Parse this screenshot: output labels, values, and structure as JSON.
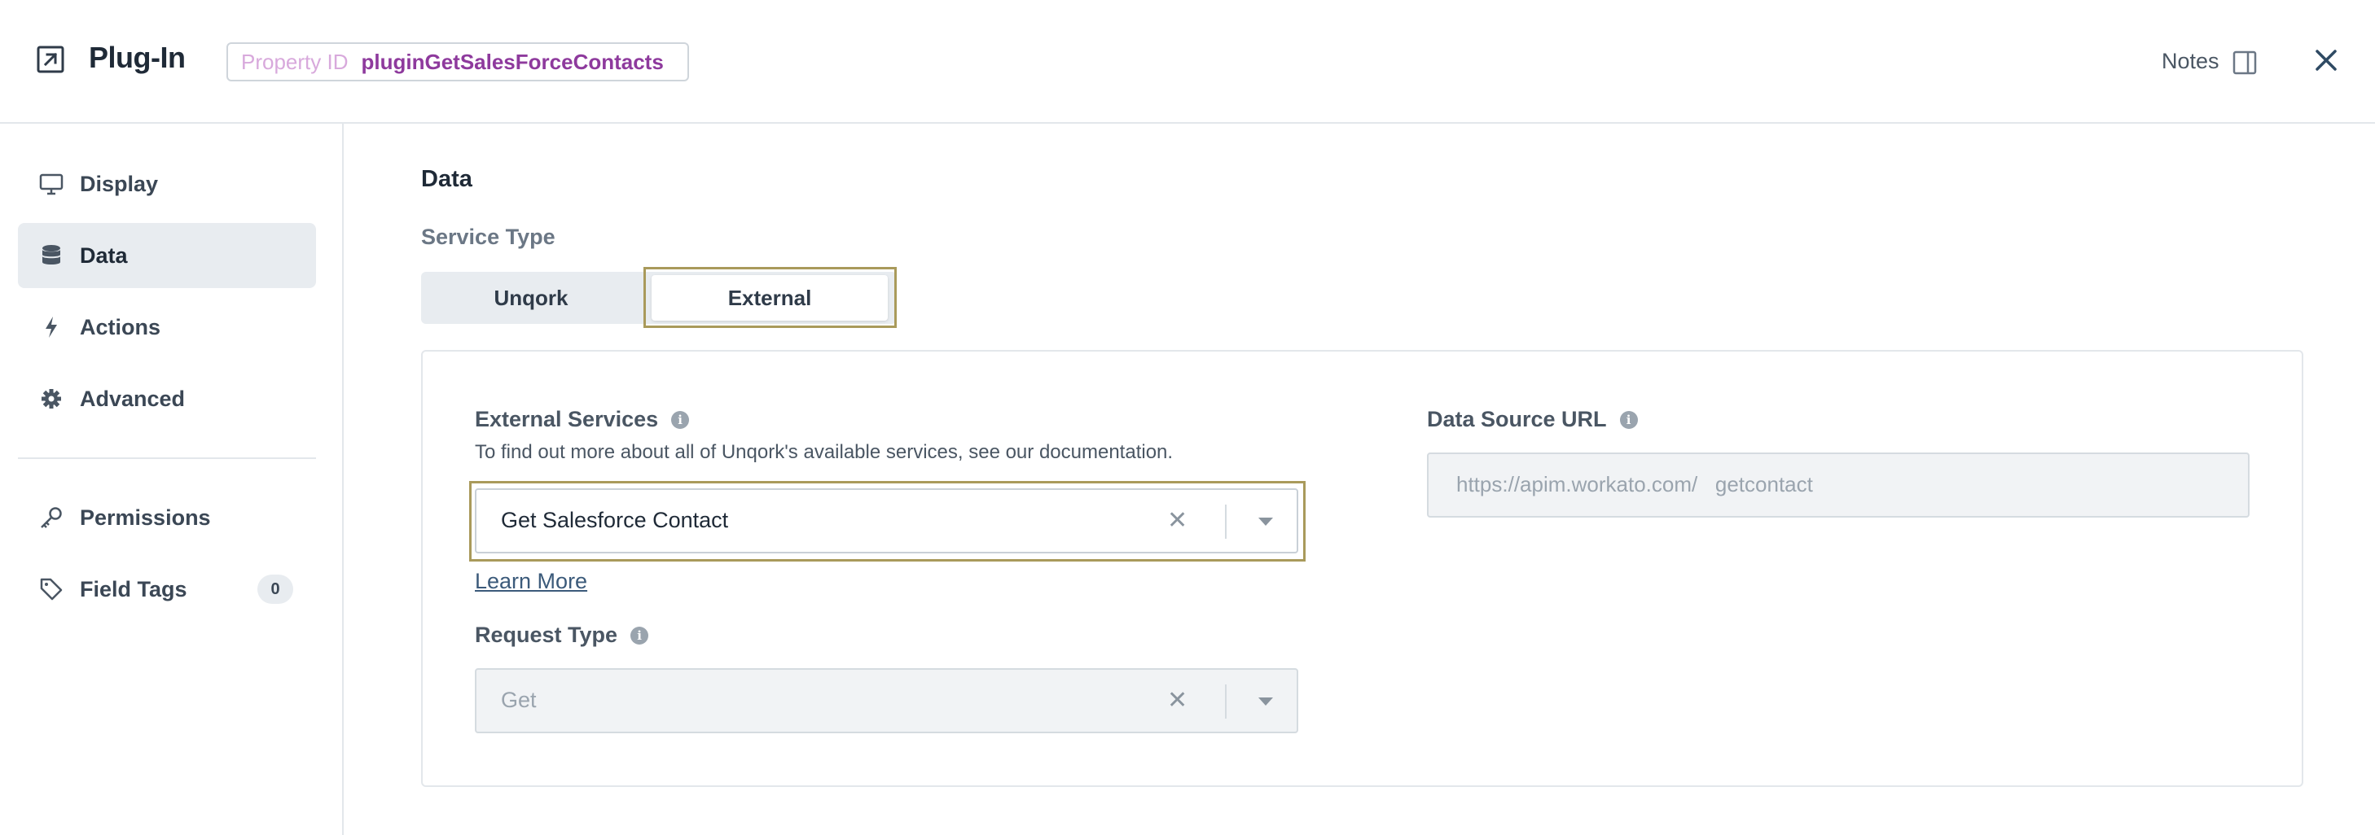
{
  "header": {
    "title": "Plug-In",
    "property_id_label": "Property ID",
    "property_id_value": "pluginGetSalesForceContacts",
    "notes_label": "Notes"
  },
  "sidebar": {
    "items": [
      {
        "label": "Display",
        "icon": "monitor-icon"
      },
      {
        "label": "Data",
        "icon": "database-icon",
        "active": true
      },
      {
        "label": "Actions",
        "icon": "lightning-icon"
      },
      {
        "label": "Advanced",
        "icon": "gear-icon"
      },
      {
        "label": "Permissions",
        "icon": "key-icon"
      },
      {
        "label": "Field Tags",
        "icon": "tag-icon",
        "count": "0"
      }
    ]
  },
  "main": {
    "section_title": "Data",
    "service_type": {
      "label": "Service Type",
      "options": [
        "Unqork",
        "External"
      ],
      "selected": "External"
    },
    "external_services": {
      "label": "External Services",
      "help": "To find out more about all of Unqork's available services, see our documentation.",
      "value": "Get Salesforce Contact",
      "learn_more": "Learn More"
    },
    "request_type": {
      "label": "Request Type",
      "value": "Get"
    },
    "data_source_url": {
      "label": "Data Source URL",
      "value": "https://apim.workato.com/   getcontact"
    }
  },
  "colors": {
    "highlight_frame": "#a99a5b",
    "property_id_value": "#8e3a9d",
    "active_sidebar_bg": "#e8ecf0"
  }
}
